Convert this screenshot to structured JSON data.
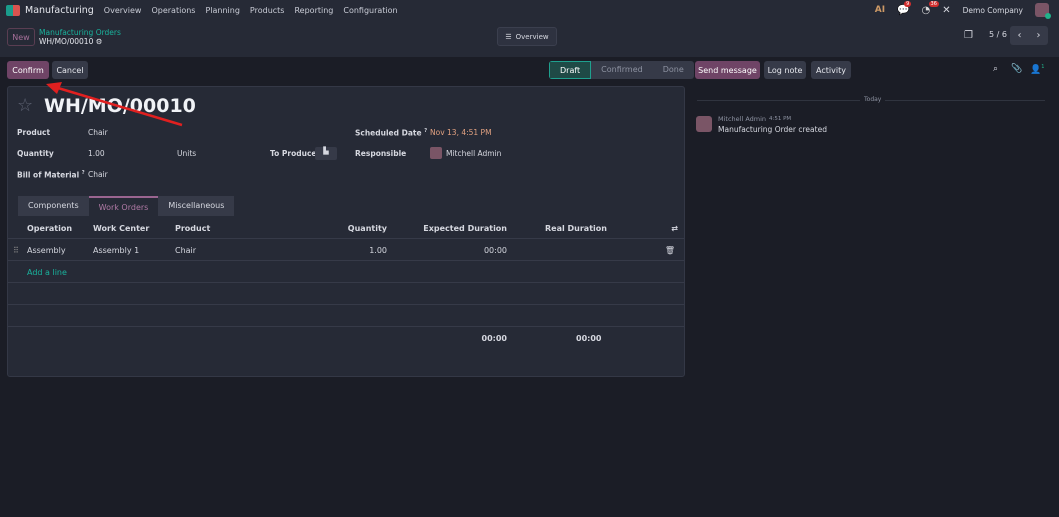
{
  "navbar": {
    "app": "Manufacturing",
    "menus": [
      "Overview",
      "Operations",
      "Planning",
      "Products",
      "Reporting",
      "Configuration"
    ],
    "messages_count": "9",
    "activities_count": "36",
    "company": "Demo Company"
  },
  "control": {
    "new": "New",
    "breadcrumb_parent": "Manufacturing Orders",
    "breadcrumb_current": "WH/MO/00010",
    "overview": "Overview",
    "pager": "5 / 6"
  },
  "actions": {
    "confirm": "Confirm",
    "cancel": "Cancel"
  },
  "status": [
    "Draft",
    "Confirmed",
    "Done"
  ],
  "form": {
    "title": "WH/MO/00010",
    "product_label": "Product",
    "product": "Chair",
    "quantity_label": "Quantity",
    "quantity": "1.00",
    "uom": "Units",
    "to_produce": "To Produce",
    "bom_label": "Bill of Material",
    "bom": "Chair",
    "scheduled_label": "Scheduled Date",
    "scheduled": "Nov 13, 4:51 PM",
    "responsible_label": "Responsible",
    "responsible": "Mitchell Admin",
    "help": "?"
  },
  "tabs": [
    "Components",
    "Work Orders",
    "Miscellaneous"
  ],
  "table": {
    "headers": [
      "Operation",
      "Work Center",
      "Product",
      "Quantity",
      "Expected Duration",
      "Real Duration"
    ],
    "row": [
      "Assembly",
      "Assembly 1",
      "Chair",
      "1.00",
      "00:00",
      ""
    ],
    "add_line": "Add a line",
    "total_expected": "00:00",
    "total_real": "00:00"
  },
  "chatter": {
    "send": "Send message",
    "log": "Log note",
    "activity": "Activity",
    "followers": "1",
    "date": "Today",
    "author": "Mitchell Admin",
    "time": "4:51 PM",
    "message": "Manufacturing Order created"
  }
}
